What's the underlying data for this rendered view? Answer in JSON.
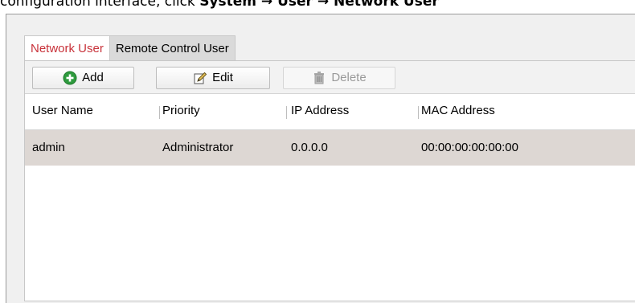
{
  "caption": {
    "prefix": "configuration interface, click ",
    "path1": "System",
    "arrow1": " → ",
    "path2": "User",
    "arrow2": " → ",
    "path3": "Network User"
  },
  "tabs": [
    {
      "label": "Network User",
      "active": true
    },
    {
      "label": "Remote Control User",
      "active": false
    }
  ],
  "toolbar": {
    "add_label": "Add",
    "edit_label": "Edit",
    "delete_label": "Delete",
    "delete_disabled": true
  },
  "table": {
    "columns": [
      "User Name",
      "Priority",
      "IP Address",
      "MAC Address"
    ],
    "rows": [
      {
        "user_name": "admin",
        "priority": "Administrator",
        "ip_address": "0.0.0.0",
        "mac_address": "00:00:00:00:00:00",
        "selected": true
      }
    ]
  },
  "colors": {
    "active_tab_text": "#c8323a",
    "add_icon": "#2e9b3e",
    "selected_row": "#ddd7d3"
  },
  "icons": {
    "add": "plus-circle-icon",
    "edit": "pencil-icon",
    "delete": "trash-icon"
  }
}
